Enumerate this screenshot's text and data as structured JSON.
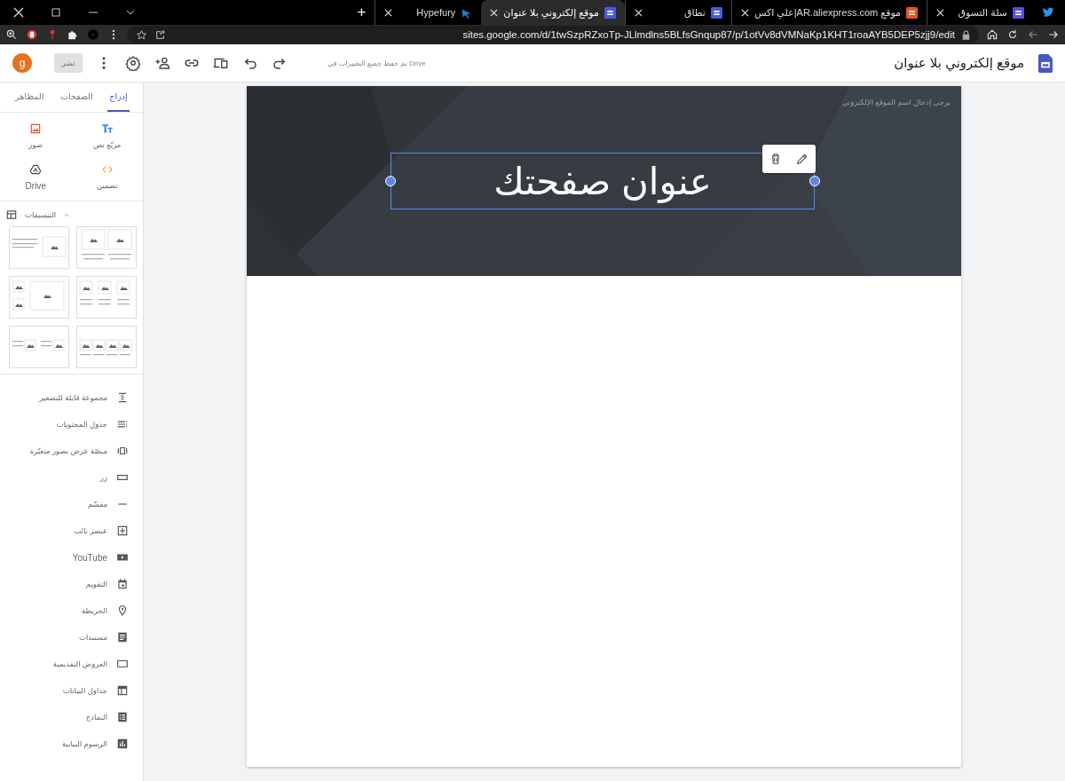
{
  "browser": {
    "tabs": [
      {
        "title": "سلة التسوق",
        "selected": false
      },
      {
        "title": "موقع AR.aliexpress.com|علي اكس",
        "selected": false
      },
      {
        "title": "نطاق",
        "selected": false
      },
      {
        "title": "موقع إلكتروني بلا عنوان",
        "selected": true
      },
      {
        "title": "Hypefury",
        "selected": false
      }
    ],
    "new_tab": "+",
    "address": "sites.google.com/d/1twSzpRZxoTp-JLlmdlns5BLfsGnqup87/p/1otVv8dVMNaKp1KHT1roaAYB5DEP5zjj9/edit"
  },
  "app": {
    "title": "موقع إلكتروني بلا عنوان",
    "save_status": "تم حفظ جميع التغييرات في Drive",
    "publish_button": {
      "label": "نشر",
      "disabled": true
    },
    "avatar": "g"
  },
  "sidebar": {
    "tabs": [
      {
        "label": "إدراج",
        "selected": true
      },
      {
        "label": "الصفحات",
        "selected": false
      },
      {
        "label": "المظاهر",
        "selected": false
      }
    ],
    "insert_items": [
      {
        "label": "مربّع نص"
      },
      {
        "label": "صور"
      },
      {
        "label": "تضمين"
      },
      {
        "label": "Drive"
      }
    ],
    "layouts": {
      "title": "التنسيقات",
      "expanded": true
    },
    "components": [
      {
        "label": "مجموعة قابلة للتصغير"
      },
      {
        "label": "جدول المحتويات"
      },
      {
        "label": "منصّة عرض بصور متغيّرة"
      },
      {
        "label": "زر"
      },
      {
        "label": "مقسّم"
      },
      {
        "label": "عنصر نائب"
      },
      {
        "label": "YouTube"
      },
      {
        "label": "التقويم"
      },
      {
        "label": "الخريطة"
      },
      {
        "label": "مستندات"
      },
      {
        "label": "العروض التقديمية"
      },
      {
        "label": "جداول البيانات"
      },
      {
        "label": "النماذج"
      },
      {
        "label": "الرسوم البيانية"
      }
    ]
  },
  "page": {
    "site_name_placeholder": "يرجى إدخال اسم الموقع الإلكتروني",
    "title": "عنوان صفحتك",
    "title_selected": true
  }
}
